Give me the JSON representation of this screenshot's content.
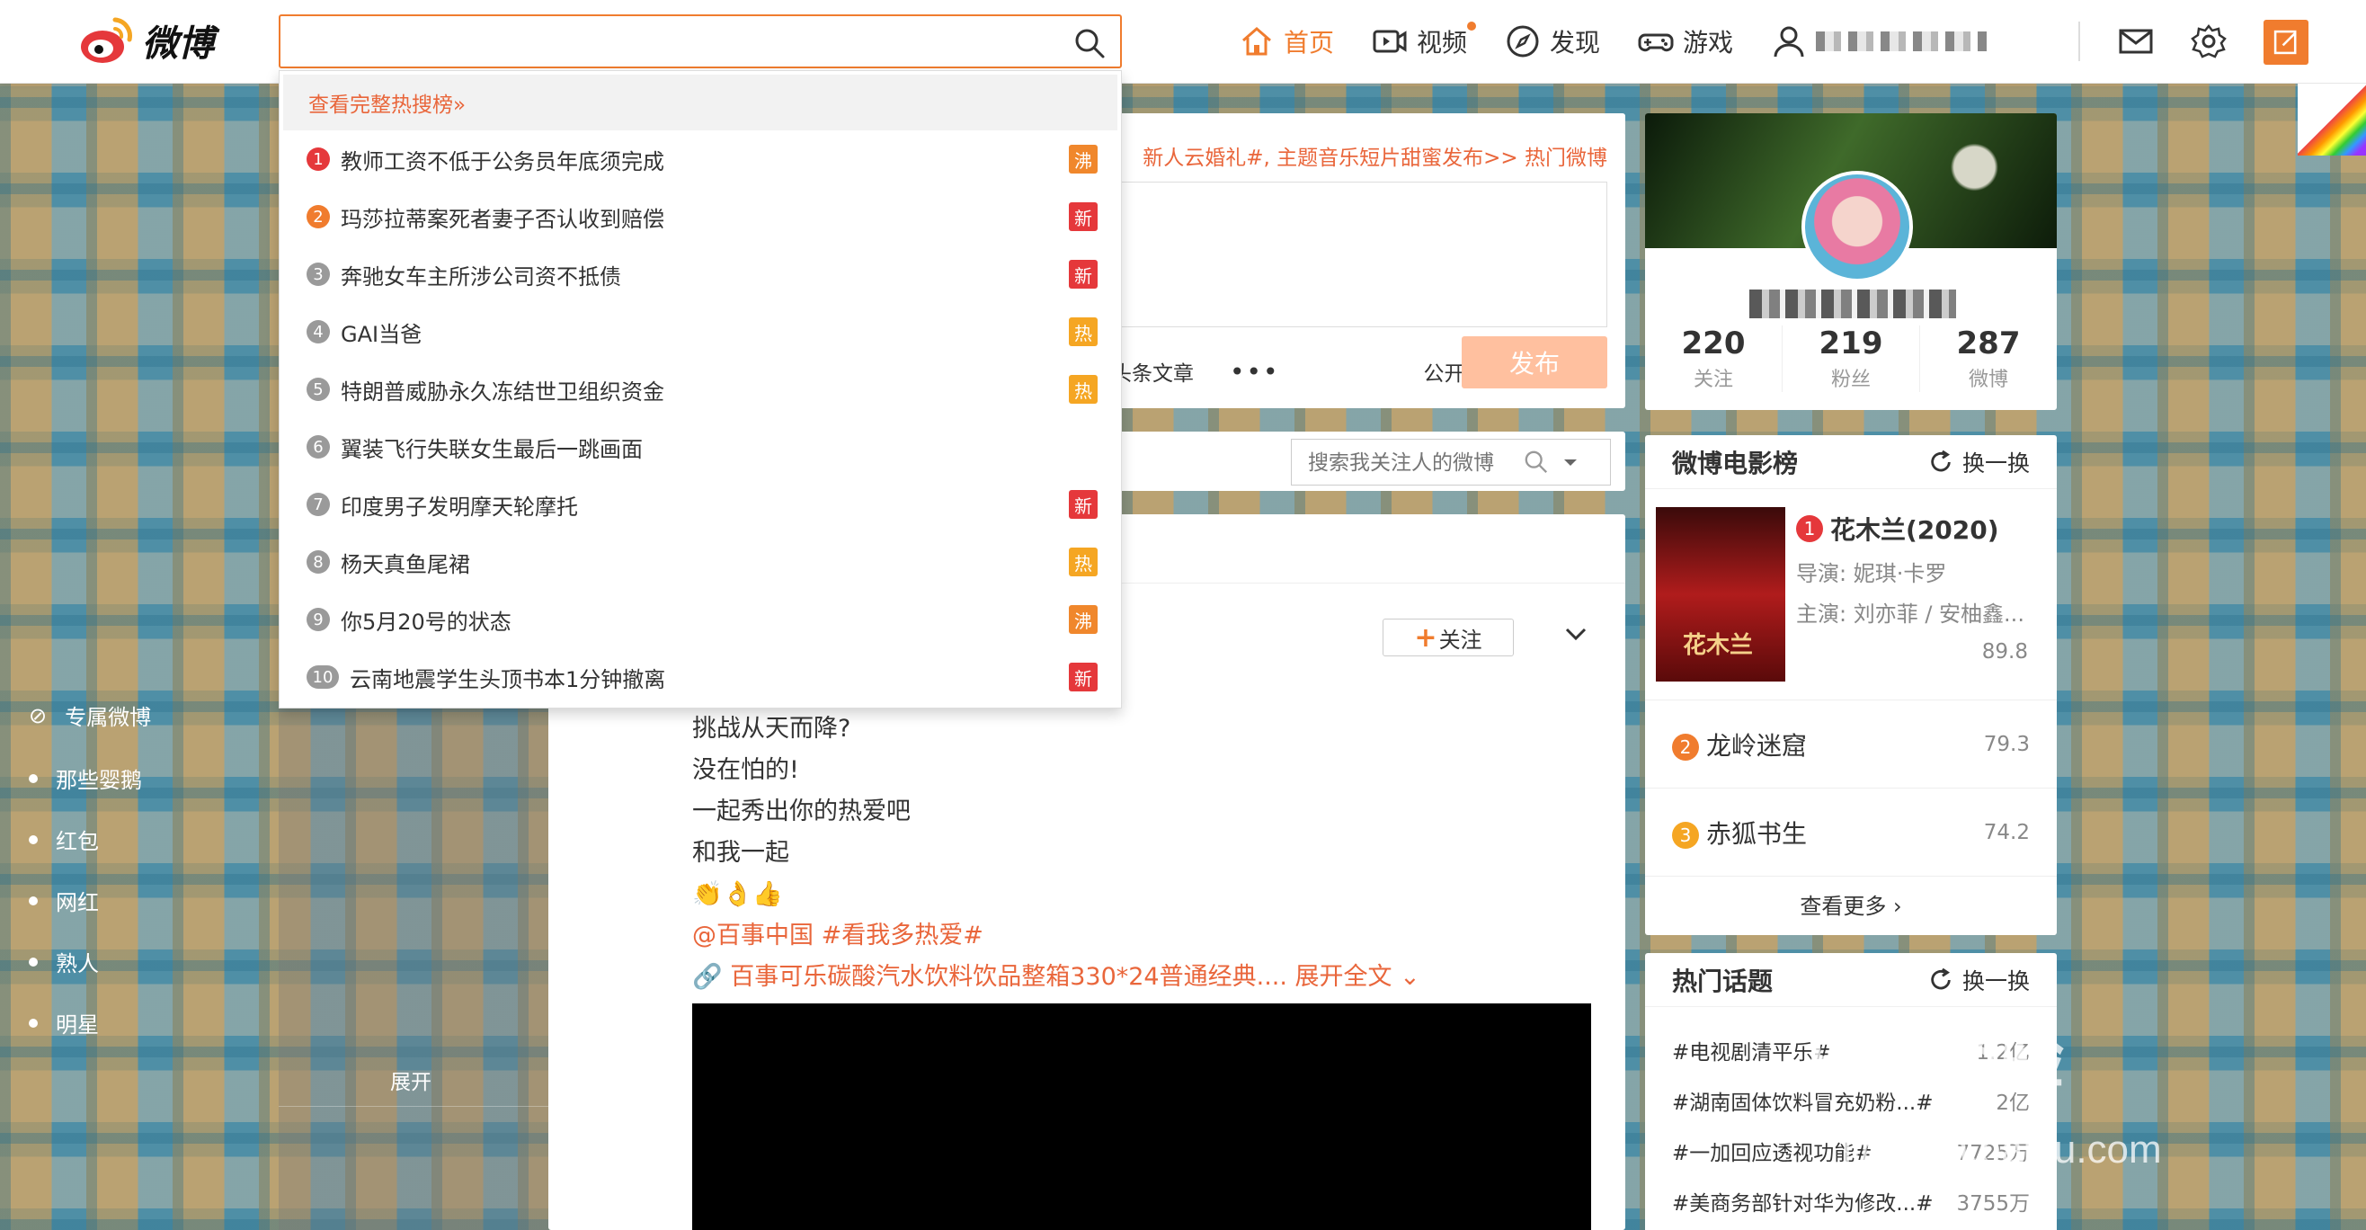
{
  "header": {
    "logo_text": "微博",
    "search": {
      "value": "",
      "placeholder": ""
    },
    "nav": [
      {
        "label": "首页",
        "icon": "home-icon",
        "active": true
      },
      {
        "label": "视频",
        "icon": "video-icon",
        "active": false
      },
      {
        "label": "发现",
        "icon": "compass-icon",
        "active": false
      },
      {
        "label": "游戏",
        "icon": "gamepad-icon",
        "active": false
      }
    ],
    "colors": {
      "accent": "#f07c2e",
      "hot_red": "#e5383b"
    }
  },
  "hot_search": {
    "view_all": "查看完整热搜榜»",
    "items": [
      {
        "rank": "1",
        "text": "教师工资不低于公务员年底须完成",
        "tag": "沸"
      },
      {
        "rank": "2",
        "text": "玛莎拉蒂案死者妻子否认收到赔偿",
        "tag": "新"
      },
      {
        "rank": "3",
        "text": "奔驰女车主所涉公司资不抵债",
        "tag": "新"
      },
      {
        "rank": "4",
        "text": "GAI当爸",
        "tag": "热"
      },
      {
        "rank": "5",
        "text": "特朗普威胁永久冻结世卫组织资金",
        "tag": "热"
      },
      {
        "rank": "6",
        "text": "翼装飞行失联女生最后一跳画面",
        "tag": ""
      },
      {
        "rank": "7",
        "text": "印度男子发明摩天轮摩托",
        "tag": "新"
      },
      {
        "rank": "8",
        "text": "杨天真鱼尾裙",
        "tag": "热"
      },
      {
        "rank": "9",
        "text": "你5月20号的状态",
        "tag": "沸"
      },
      {
        "rank": "10",
        "text": "云南地震学生头顶书本1分钟撤离",
        "tag": "新"
      }
    ]
  },
  "composer": {
    "hint": "新人云婚礼#, 主题音乐短片甜蜜发布>>  热门微博",
    "tool_article": "头条文章",
    "tool_more": "•••",
    "visibility": "公开",
    "publish": "发布"
  },
  "feed": {
    "filter_placeholder": "搜索我关注人的微博",
    "follow_label": "关注",
    "post_lines": [
      "挑战从天而降?",
      "没在怕的!",
      "一起秀出你的热爱吧",
      "和我一起",
      "👏👌👍"
    ],
    "post_mentions": "@百事中国 #看我多热爱#",
    "post_link": "百事可乐碳酸汽水饮料饮品整箱330*24普通经典....",
    "post_expand": "展开全文"
  },
  "sidebar": {
    "section_label": "专属微博",
    "items": [
      "那些婴鹅",
      "红包",
      "网红",
      "熟人",
      "明星"
    ],
    "expand": "展开"
  },
  "profile": {
    "stats": [
      {
        "num": "220",
        "label": "关注"
      },
      {
        "num": "219",
        "label": "粉丝"
      },
      {
        "num": "287",
        "label": "微博"
      }
    ]
  },
  "movie_board": {
    "title": "微博电影榜",
    "refresh": "换一换",
    "top": {
      "rank": "1",
      "name": "花木兰(2020)",
      "director": "导演: 妮琪·卡罗",
      "cast": "主演: 刘亦菲 / 安柚鑫...",
      "score": "89.8",
      "poster_text": "花木兰"
    },
    "others": [
      {
        "rank": "2",
        "name": "龙岭迷窟",
        "score": "79.3"
      },
      {
        "rank": "3",
        "name": "赤狐书生",
        "score": "74.2"
      }
    ],
    "see_more": "查看更多 ›"
  },
  "hot_topics": {
    "title": "热门话题",
    "refresh": "换一换",
    "items": [
      {
        "text": "#电视剧清平乐#",
        "count": "1.2亿"
      },
      {
        "text": "#湖南固体饮料冒充奶粉...#",
        "count": "2亿"
      },
      {
        "text": "#一加回应透视功能#",
        "count": "7725万"
      },
      {
        "text": "#美商务部针对华为修改...#",
        "count": "3755万"
      }
    ]
  },
  "watermark": {
    "brand": "Bai 经验",
    "url": "jingyan.baidu.com"
  }
}
